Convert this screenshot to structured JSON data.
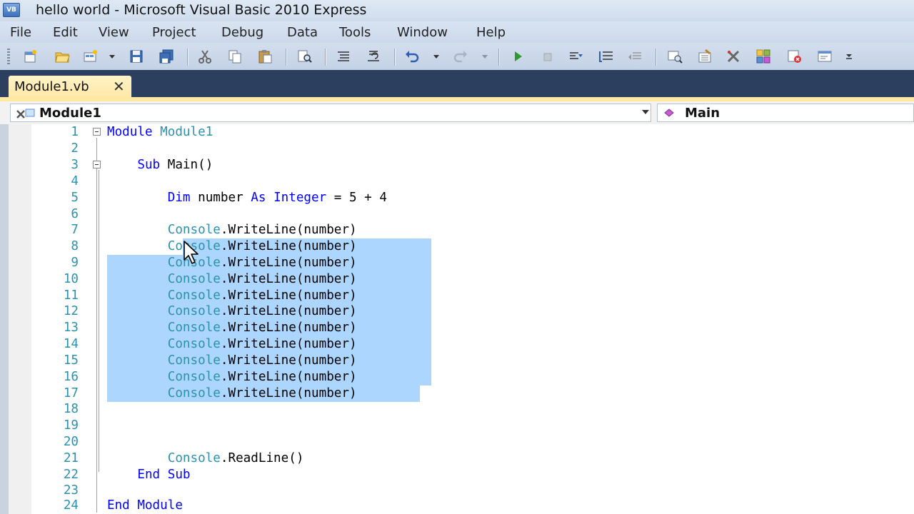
{
  "window": {
    "title": "hello world - Microsoft Visual Basic 2010 Express",
    "app_icon_text": "VB"
  },
  "menu": [
    "File",
    "Edit",
    "View",
    "Project",
    "Debug",
    "Data",
    "Tools",
    "Window",
    "Help"
  ],
  "toolbar": {
    "buttons": [
      "new-project-icon",
      "open-file-icon",
      "add-item-icon",
      "save-icon",
      "save-all-icon",
      "cut-icon",
      "copy-icon",
      "paste-icon",
      "find-icon",
      "comment-icon",
      "uncomment-icon",
      "undo-icon",
      "redo-icon",
      "start-debugging-icon",
      "stop-debugging-icon",
      "step-into-icon",
      "step-over-icon",
      "step-out-icon",
      "solution-explorer-icon",
      "properties-icon",
      "toolbox-icon",
      "object-browser-icon",
      "error-list-icon",
      "output-icon"
    ]
  },
  "tab": {
    "label": "Module1.vb",
    "close_glyph": "✕"
  },
  "navigation": {
    "type_selector": "Module1",
    "member_selector": "Main"
  },
  "editor": {
    "lines": [
      {
        "n": "1",
        "text": "Module Module1"
      },
      {
        "n": "2",
        "text": ""
      },
      {
        "n": "3",
        "text": "    Sub Main()"
      },
      {
        "n": "4",
        "text": ""
      },
      {
        "n": "5",
        "text": "        Dim number As Integer = 5 + 4"
      },
      {
        "n": "6",
        "text": ""
      },
      {
        "n": "7",
        "text": "        Console.WriteLine(number)"
      },
      {
        "n": "8",
        "text": "        Console.WriteLine(number)"
      },
      {
        "n": "9",
        "text": "        Console.WriteLine(number)"
      },
      {
        "n": "10",
        "text": "        Console.WriteLine(number)"
      },
      {
        "n": "11",
        "text": "        Console.WriteLine(number)"
      },
      {
        "n": "12",
        "text": "        Console.WriteLine(number)"
      },
      {
        "n": "13",
        "text": "        Console.WriteLine(number)"
      },
      {
        "n": "14",
        "text": "        Console.WriteLine(number)"
      },
      {
        "n": "15",
        "text": "        Console.WriteLine(number)"
      },
      {
        "n": "16",
        "text": "        Console.WriteLine(number)"
      },
      {
        "n": "17",
        "text": "        Console.WriteLine(number)"
      },
      {
        "n": "18",
        "text": ""
      },
      {
        "n": "19",
        "text": ""
      },
      {
        "n": "20",
        "text": ""
      },
      {
        "n": "21",
        "text": "        Console.ReadLine()"
      },
      {
        "n": "22",
        "text": "    End Sub"
      },
      {
        "n": "23",
        "text": ""
      },
      {
        "n": "24",
        "text": "End Module"
      }
    ],
    "selection": {
      "from_line": 8,
      "to_line": 17
    },
    "colors": {
      "keyword": "#0000ff",
      "type": "#2b91af",
      "line_number": "#2b91af",
      "selection": "#add6ff"
    }
  }
}
